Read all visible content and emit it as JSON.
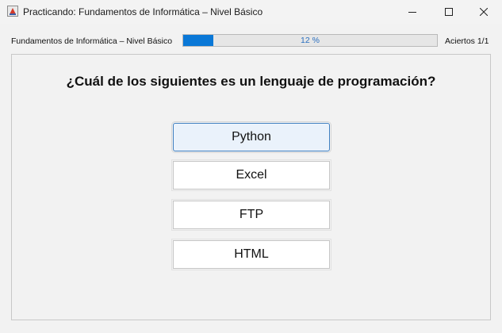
{
  "window": {
    "title": "Practicando: Fundamentos de Informática – Nivel Básico",
    "icon": "java-cup-icon",
    "controls": [
      "minimize-icon",
      "maximize-icon",
      "close-icon"
    ]
  },
  "progress": {
    "label": "Fundamentos de Informática – Nivel Básico",
    "percent": 12,
    "text": "12 %",
    "fill_color": "#0a78d7"
  },
  "score": {
    "text": "Aciertos 1/1"
  },
  "question": {
    "text": "¿Cuál de los siguientes es un lenguaje de programación?"
  },
  "options": [
    {
      "label": "Python",
      "selected": true
    },
    {
      "label": "Excel",
      "selected": false
    },
    {
      "label": "FTP",
      "selected": false
    },
    {
      "label": "HTML",
      "selected": false
    }
  ]
}
